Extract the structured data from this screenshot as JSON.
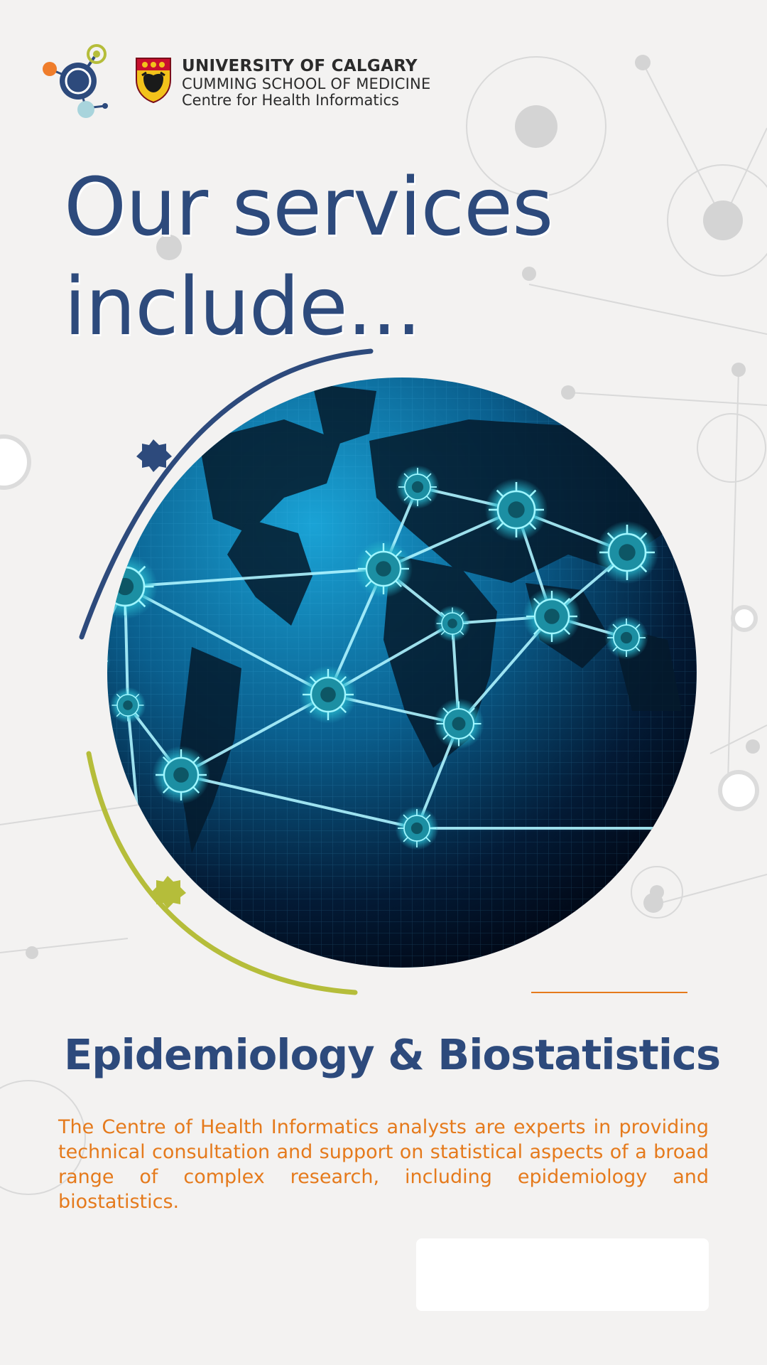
{
  "header": {
    "university": "UNIVERSITY OF CALGARY",
    "school": "CUMMING SCHOOL OF MEDICINE",
    "centre": "Centre for Health Informatics"
  },
  "headline": {
    "line1": "Our services",
    "line2": "include..."
  },
  "service": {
    "title": "Epidemiology & Biostatistics",
    "description": "The Centre of Health Informatics analysts are experts in providing technical consultation and support on statistical aspects of a broad range of complex research, including epidemiology and biostatistics."
  },
  "colors": {
    "navy": "#2d4a7c",
    "orange": "#e57a1c",
    "lime": "#b5bd3a",
    "background": "#f3f2f1"
  },
  "icons": [
    "molecule-logo-icon",
    "university-crest-icon",
    "virus-globe-illustration"
  ]
}
